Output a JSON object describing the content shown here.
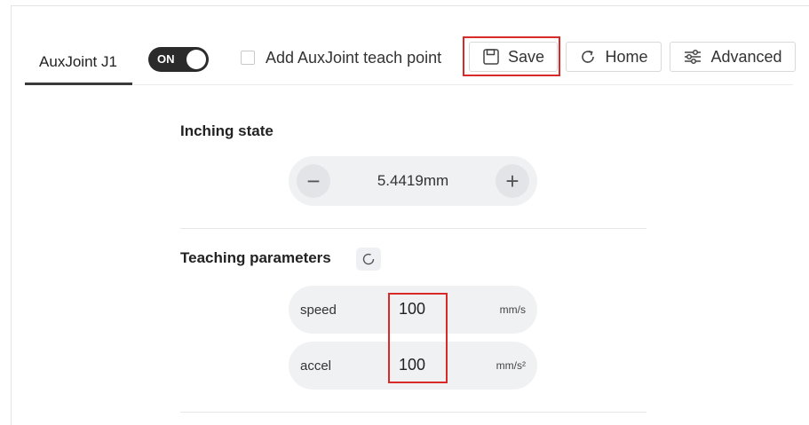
{
  "tab": {
    "label": "AuxJoint J1"
  },
  "toggle": {
    "label": "ON",
    "state": "on"
  },
  "teach_point": {
    "label": "Add AuxJoint teach point",
    "checked": false
  },
  "toolbar": {
    "save_label": "Save",
    "home_label": "Home",
    "advanced_label": "Advanced"
  },
  "inching": {
    "title": "Inching state",
    "minus": "−",
    "plus": "+",
    "value": "5.4419mm"
  },
  "teaching": {
    "title": "Teaching parameters",
    "params": [
      {
        "name": "speed",
        "value": "100",
        "unit": "mm/s"
      },
      {
        "name": "accel",
        "value": "100",
        "unit": "mm/s²"
      }
    ]
  },
  "colors": {
    "highlight": "#d92a2a",
    "toggle_bg": "#2b2b2b",
    "pill_bg": "#f0f1f3"
  }
}
